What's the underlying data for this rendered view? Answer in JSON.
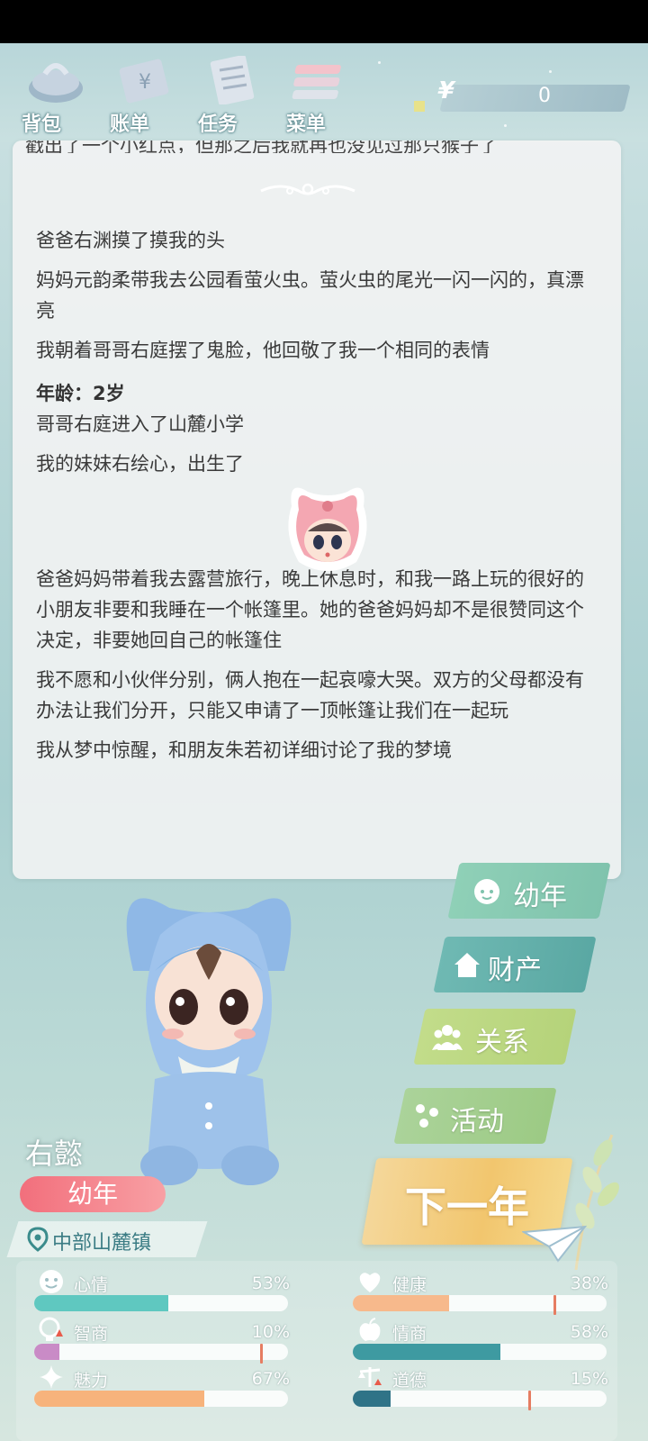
{
  "menu": [
    {
      "label": "背包",
      "icon": "bag-icon"
    },
    {
      "label": "账单",
      "icon": "bill-icon"
    },
    {
      "label": "任务",
      "icon": "task-icon"
    },
    {
      "label": "菜单",
      "icon": "menu-icon"
    }
  ],
  "money": {
    "symbol": "¥",
    "value": "0"
  },
  "log": {
    "cut_line": "戳出了一个小红点，但那之后我就再也没见过那只猴子了",
    "entries_before": [
      "爸爸右渊摸了摸我的头",
      "妈妈元韵柔带我去公园看萤火虫。萤火虫的尾光一闪一闪的，真漂亮",
      "我朝着哥哥右庭摆了鬼脸，他回敬了我一个相同的表情"
    ],
    "age_heading": "年龄：2岁",
    "entries_after_age": [
      "哥哥右庭进入了山麓小学",
      "我的妹妹右绘心，出生了"
    ],
    "entries_after_avatar": [
      "爸爸妈妈带着我去露营旅行，晚上休息时，和我一路上玩的很好的小朋友非要和我睡在一个帐篷里。她的爸爸妈妈却不是很赞同这个决定，非要她回自己的帐篷住",
      "我不愿和小伙伴分别，俩人抱在一起哀嚎大哭。双方的父母都没有办法让我们分开，只能又申请了一顶帐篷让我们在一起玩",
      "我从梦中惊醒，和朋友朱若初详细讨论了我的梦境"
    ]
  },
  "side_buttons": [
    {
      "label": "幼年",
      "icon": "baby-face-icon",
      "color": "#7fc3ad"
    },
    {
      "label": "财产",
      "icon": "house-icon",
      "color": "#5aa8a3"
    },
    {
      "label": "关系",
      "icon": "people-icon",
      "color": "#b5d37a"
    },
    {
      "label": "活动",
      "icon": "activity-icon",
      "color": "#9cca84"
    }
  ],
  "next_year": "下一年",
  "character": {
    "name": "右懿",
    "stage": "幼年",
    "location": "中部山麓镇"
  },
  "stats": [
    {
      "label": "心情",
      "percent": "53%",
      "value": 0.53,
      "color": "#5fc8c0",
      "icon": "smile-icon",
      "marker": null
    },
    {
      "label": "健康",
      "percent": "38%",
      "value": 0.38,
      "color": "#f7b98c",
      "icon": "heart-icon",
      "marker": 0.79
    },
    {
      "label": "智商",
      "percent": "10%",
      "value": 0.1,
      "color": "#c98bc6",
      "icon": "bulb-icon",
      "marker": 0.89
    },
    {
      "label": "情商",
      "percent": "58%",
      "value": 0.58,
      "color": "#3e9aa1",
      "icon": "apple-icon",
      "marker": null
    },
    {
      "label": "魅力",
      "percent": "67%",
      "value": 0.67,
      "color": "#f7b37c",
      "icon": "sparkle-icon",
      "marker": null
    },
    {
      "label": "道德",
      "percent": "15%",
      "value": 0.15,
      "color": "#2f7387",
      "icon": "scale-icon",
      "marker": 0.69
    }
  ]
}
